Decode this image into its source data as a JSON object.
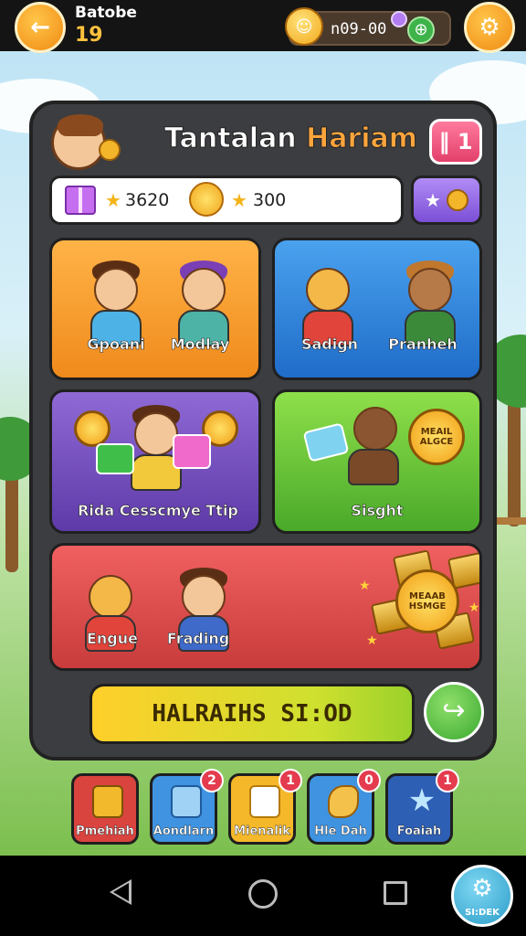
{
  "topbar": {
    "player_name": "Batobe",
    "player_level": "19",
    "currency_value": "n09-00",
    "back_icon": "back-arrow-icon",
    "settings_icon": "gear-icon"
  },
  "panel": {
    "title_part1": "Tantalan",
    "title_part2": "Hariam",
    "badge": "‖ 1",
    "resources": [
      {
        "icon": "star-icon",
        "value": "3620"
      },
      {
        "icon": "star-icon",
        "value": "300"
      }
    ]
  },
  "tiles": {
    "orange": {
      "labels": [
        "Gpoani",
        "Modlay"
      ]
    },
    "blue": {
      "labels": [
        "Sadign",
        "Pranheh"
      ]
    },
    "purple": {
      "label": "Rida Cesscmye Ttip"
    },
    "green": {
      "label": "Sisght",
      "coin_text": "MEAIL ALGCE"
    },
    "red": {
      "labels": [
        "Engue",
        "Frading"
      ],
      "coin_text": "MEAAB HSMGE"
    }
  },
  "cta": {
    "label": "HALRAIHS SI:OD"
  },
  "bottom_nav": [
    {
      "label": "Pmehiah",
      "color": "#d9443f",
      "badge": ""
    },
    {
      "label": "Aondlarn",
      "color": "#3f93e0",
      "badge": "2"
    },
    {
      "label": "Mienalik",
      "color": "#f5b82a",
      "badge": "1"
    },
    {
      "label": "Hle Dah",
      "color": "#3f93e0",
      "badge": "0"
    },
    {
      "label": "Foaiah",
      "color": "#2d5fb5",
      "badge": "1"
    }
  ],
  "float_button": {
    "label": "SI:DEK"
  },
  "colors": {
    "accent": "#f08a12",
    "panel": "#3b3d40",
    "cta": "#ffcf2a"
  }
}
